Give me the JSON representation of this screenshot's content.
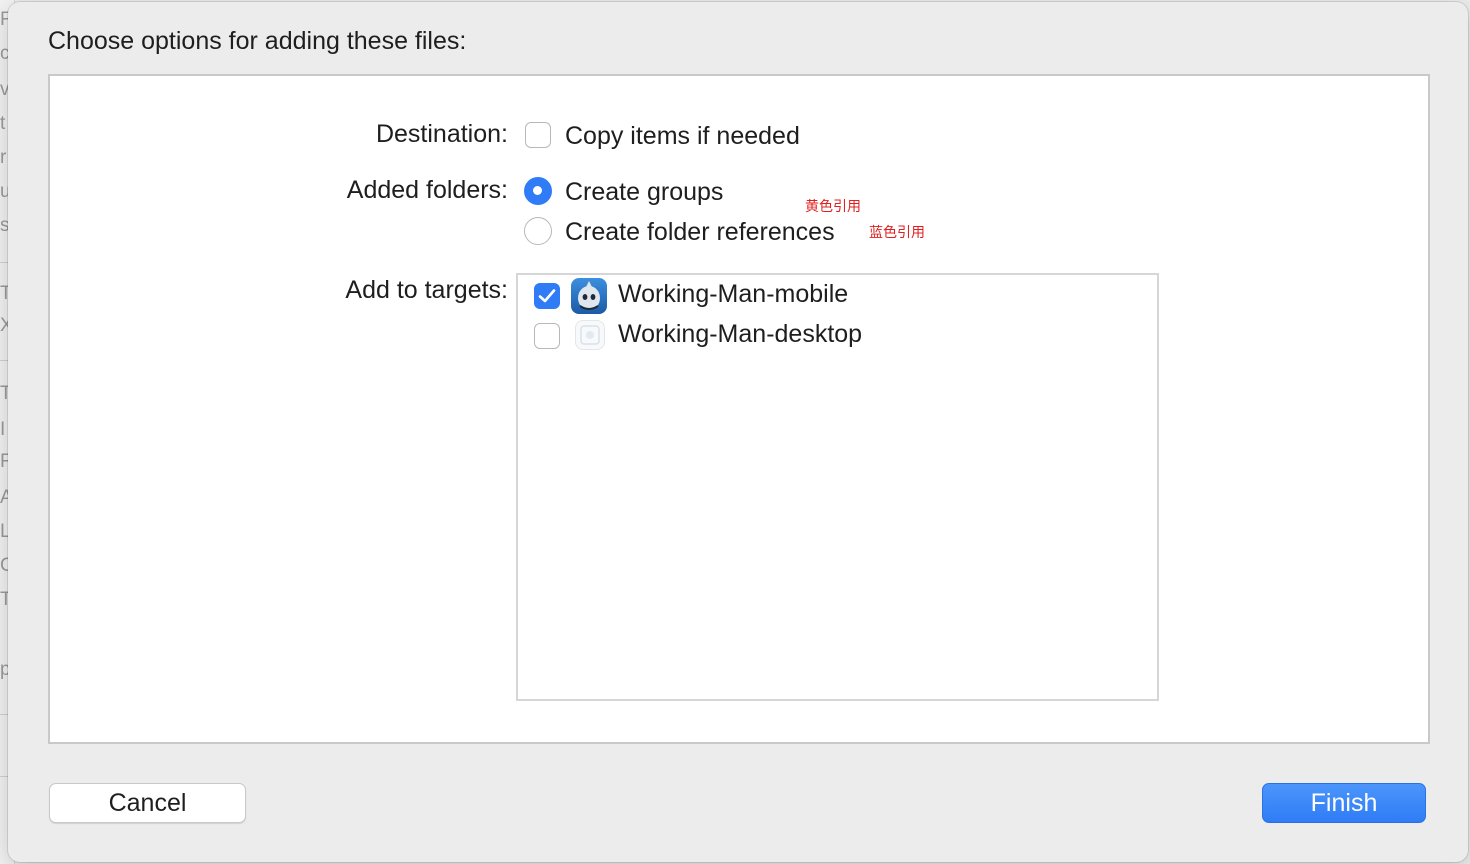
{
  "dialog": {
    "header": "Choose options for adding these files:"
  },
  "destination": {
    "label": "Destination:",
    "option": {
      "label": "Copy items if needed",
      "checked": false
    }
  },
  "added_folders": {
    "label": "Added folders:",
    "options": [
      {
        "label": "Create groups",
        "selected": true,
        "note": "黄色引用"
      },
      {
        "label": "Create folder references",
        "selected": false,
        "note": "蓝色引用"
      }
    ]
  },
  "add_to_targets": {
    "label": "Add to targets:",
    "targets": [
      {
        "name": "Working-Man-mobile",
        "checked": true,
        "icon": "cocos-app-icon"
      },
      {
        "name": "Working-Man-desktop",
        "checked": false,
        "icon": "generic-app-icon"
      }
    ]
  },
  "buttons": {
    "cancel": "Cancel",
    "finish": "Finish"
  },
  "colors": {
    "accent": "#2f7cf6",
    "annotation": "#e02020"
  }
}
